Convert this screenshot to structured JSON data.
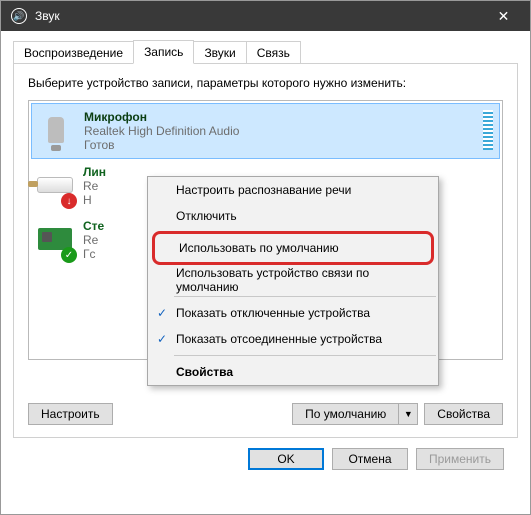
{
  "window": {
    "title": "Звук"
  },
  "tabs": {
    "t1": "Воспроизведение",
    "t2": "Запись",
    "t3": "Звуки",
    "t4": "Связь"
  },
  "hint": "Выберите устройство записи, параметры которого нужно изменить:",
  "devices": {
    "mic": {
      "name": "Микрофон",
      "sub": "Realtek High Definition Audio",
      "status": "Готов"
    },
    "line": {
      "name": "Лин",
      "sub": "Re",
      "status": "Н"
    },
    "mix": {
      "name": "Сте",
      "sub": "Re",
      "status": "Гс"
    }
  },
  "ctx": {
    "m1": "Настроить распознавание речи",
    "m2": "Отключить",
    "m3": "Использовать по умолчанию",
    "m4": "Использовать устройство связи по умолчанию",
    "m5": "Показать отключенные устройства",
    "m6": "Показать отсоединенные устройства",
    "m7": "Свойства"
  },
  "panel": {
    "configure": "Настроить",
    "default": "По умолчанию",
    "props": "Свойства"
  },
  "dlg": {
    "ok": "OK",
    "cancel": "Отмена",
    "apply": "Применить"
  }
}
